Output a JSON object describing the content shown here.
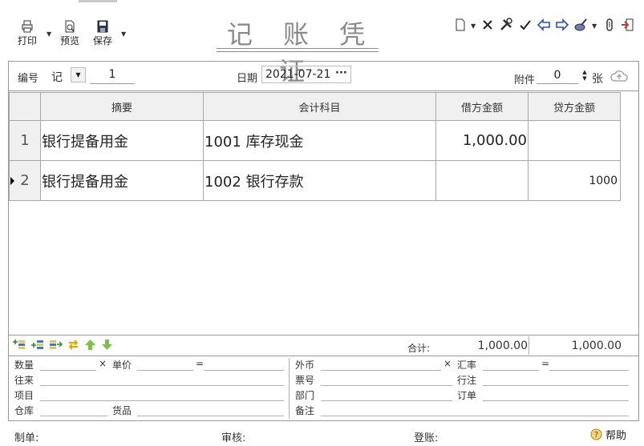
{
  "toolbar": {
    "print_label": "打印",
    "preview_label": "预览",
    "save_label": "保存"
  },
  "title": "记 账 凭 证",
  "header": {
    "number_label": "编号",
    "voucher_type": "记",
    "voucher_number": "1",
    "date_label": "日期",
    "date_value": "2021-07-21",
    "date_button": "···",
    "attachment_label": "附件",
    "attachment_count": "0",
    "attachment_unit": "张"
  },
  "grid": {
    "columns": [
      "摘要",
      "会计科目",
      "借方金额",
      "贷方金额"
    ],
    "rows": [
      {
        "no": "1",
        "summary": "银行提备用金",
        "account": "1001 库存现金",
        "debit": "1,000.00",
        "credit": ""
      },
      {
        "no": "2",
        "summary": "银行提备用金",
        "account": "1002 银行存款",
        "debit": "",
        "credit": "1000"
      }
    ]
  },
  "totals": {
    "label": "合计:",
    "debit": "1,000.00",
    "credit": "1,000.00"
  },
  "footer_fields": {
    "quantity": "数量",
    "times": "×",
    "unit_price": "单价",
    "equals": "=",
    "contact": "往来",
    "project": "项目",
    "warehouse": "仓库",
    "goods": "货品",
    "currency": "外币",
    "exchange_rate": "汇率",
    "bill_no": "票号",
    "bank": "行注",
    "department": "部门",
    "order": "订单",
    "remark": "备注"
  },
  "status_bar": {
    "maker": "制单:",
    "reviewer": "审核:",
    "poster": "登账:",
    "help": "帮助"
  },
  "colors": {
    "title_gray": "#8a8a8a",
    "grid_header_bg": "#f0f0f0",
    "icon_green": "#7cc04a",
    "icon_blue": "#2c4fb8"
  }
}
